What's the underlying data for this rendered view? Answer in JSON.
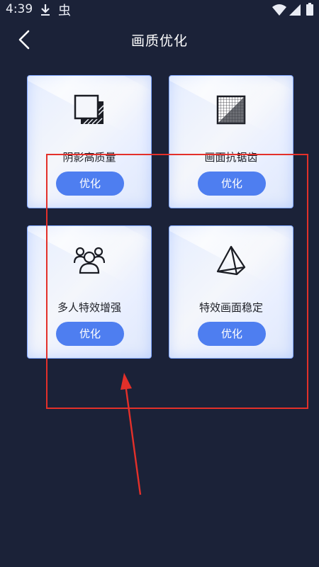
{
  "status_bar": {
    "time": "4:39",
    "bug_glyph": "虫",
    "icons": [
      "download-icon",
      "wifi-icon",
      "signal-icon",
      "battery-icon"
    ]
  },
  "header": {
    "title": "画质优化",
    "back_icon": "chevron-left-icon"
  },
  "cards": [
    {
      "label": "阴影高质量",
      "button": "优化",
      "icon": "shadow-square-icon"
    },
    {
      "label": "画面抗锯齿",
      "button": "优化",
      "icon": "pixel-grid-icon"
    },
    {
      "label": "多人特效增强",
      "button": "优化",
      "icon": "multi-user-icon"
    },
    {
      "label": "特效画面稳定",
      "button": "优化",
      "icon": "pyramid-icon"
    }
  ],
  "annotation": {
    "box_color": "#e3302a",
    "arrow_color": "#e3302a"
  },
  "colors": {
    "background": "#1b2238",
    "button": "#4e7ef0",
    "card_border": "#7fa6ff"
  }
}
